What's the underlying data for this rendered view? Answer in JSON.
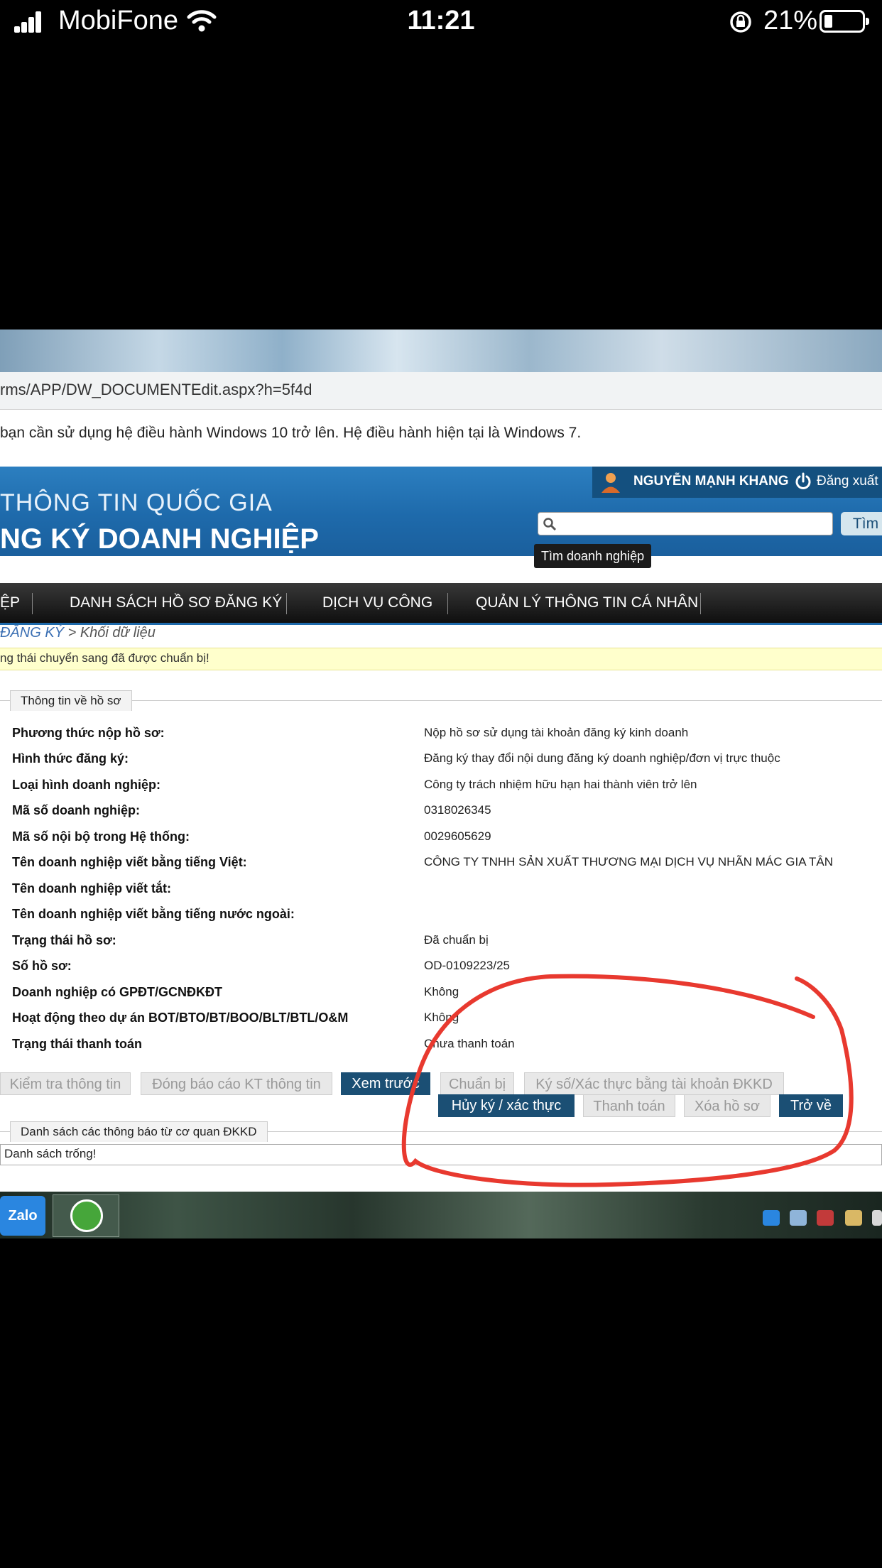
{
  "status_bar": {
    "carrier": "MobiFone",
    "time": "11:21",
    "battery": "21%"
  },
  "browser": {
    "url": "rms/APP/DW_DOCUMENTEdit.aspx?h=5f4d"
  },
  "warning": "bạn cần sử dụng hệ điều hành Windows 10 trở lên. Hệ điều hành hiện tại là Windows 7.",
  "header": {
    "line1": "THÔNG TIN QUỐC GIA",
    "line2": "NG KÝ DOANH NGHIỆP",
    "user": "NGUYỄN MẠNH KHANG",
    "logout": "Đăng xuất",
    "search_button": "Tìm",
    "search_tooltip": "Tìm doanh nghiệp"
  },
  "nav": [
    "ỆP",
    "DANH SÁCH HỒ SƠ ĐĂNG KÝ",
    "DỊCH VỤ CÔNG",
    "QUẢN LÝ THÔNG TIN CÁ NHÂN"
  ],
  "breadcrumb": {
    "link": "ĐĂNG KÝ",
    "sep": " > ",
    "current": "Khối dữ liệu"
  },
  "notice": "ng thái chuyển sang đã được chuẩn bị!",
  "section_info": "Thông tin về hồ sơ",
  "fields": [
    {
      "label": "Phương thức nộp hồ sơ:",
      "value": "Nộp hồ sơ sử dụng tài khoản đăng ký kinh doanh"
    },
    {
      "label": "Hình thức đăng ký:",
      "value": "Đăng ký thay đổi nội dung đăng ký doanh nghiệp/đơn vị trực thuộc"
    },
    {
      "label": "Loại hình doanh nghiệp:",
      "value": "Công ty trách nhiệm hữu hạn hai thành viên trở lên"
    },
    {
      "label": "Mã số doanh nghiệp:",
      "value": "0318026345"
    },
    {
      "label": "Mã số nội bộ trong Hệ thống:",
      "value": "0029605629"
    },
    {
      "label": "Tên doanh nghiệp viết bằng tiếng Việt:",
      "value": "CÔNG TY TNHH SẢN XUẤT THƯƠNG MẠI DỊCH VỤ NHÃN MÁC GIA TÂN"
    },
    {
      "label": "Tên doanh nghiệp viết tắt:",
      "value": ""
    },
    {
      "label": "Tên doanh nghiệp viết bằng tiếng nước ngoài:",
      "value": ""
    },
    {
      "label": "Trạng thái hồ sơ:",
      "value": "Đã chuẩn bị"
    },
    {
      "label": "Số hồ sơ:",
      "value": "OD-0109223/25"
    },
    {
      "label": "Doanh nghiệp có GPĐT/GCNĐKĐT",
      "value": "Không"
    },
    {
      "label": "Hoạt động theo dự án BOT/BTO/BT/BOO/BLT/BTL/O&M",
      "value": "Không"
    },
    {
      "label": "Trạng thái thanh toán",
      "value": "Chưa thanh toán"
    }
  ],
  "buttons_row1": [
    "Kiểm tra thông tin",
    "Đóng báo cáo KT thông tin",
    "Xem trước",
    "Chuẩn bị",
    "Ký số/Xác thực bằng tài khoản ĐKKD"
  ],
  "buttons_row2": [
    "Hủy ký / xác thực",
    "Thanh toán",
    "Xóa hồ sơ",
    "Trở về"
  ],
  "section_notices": "Danh sách các thông báo từ cơ quan ĐKKD",
  "empty_list": "Danh sách trống!",
  "taskbar": {
    "zalo": "Zalo"
  },
  "annotation_color": "#e8392f"
}
